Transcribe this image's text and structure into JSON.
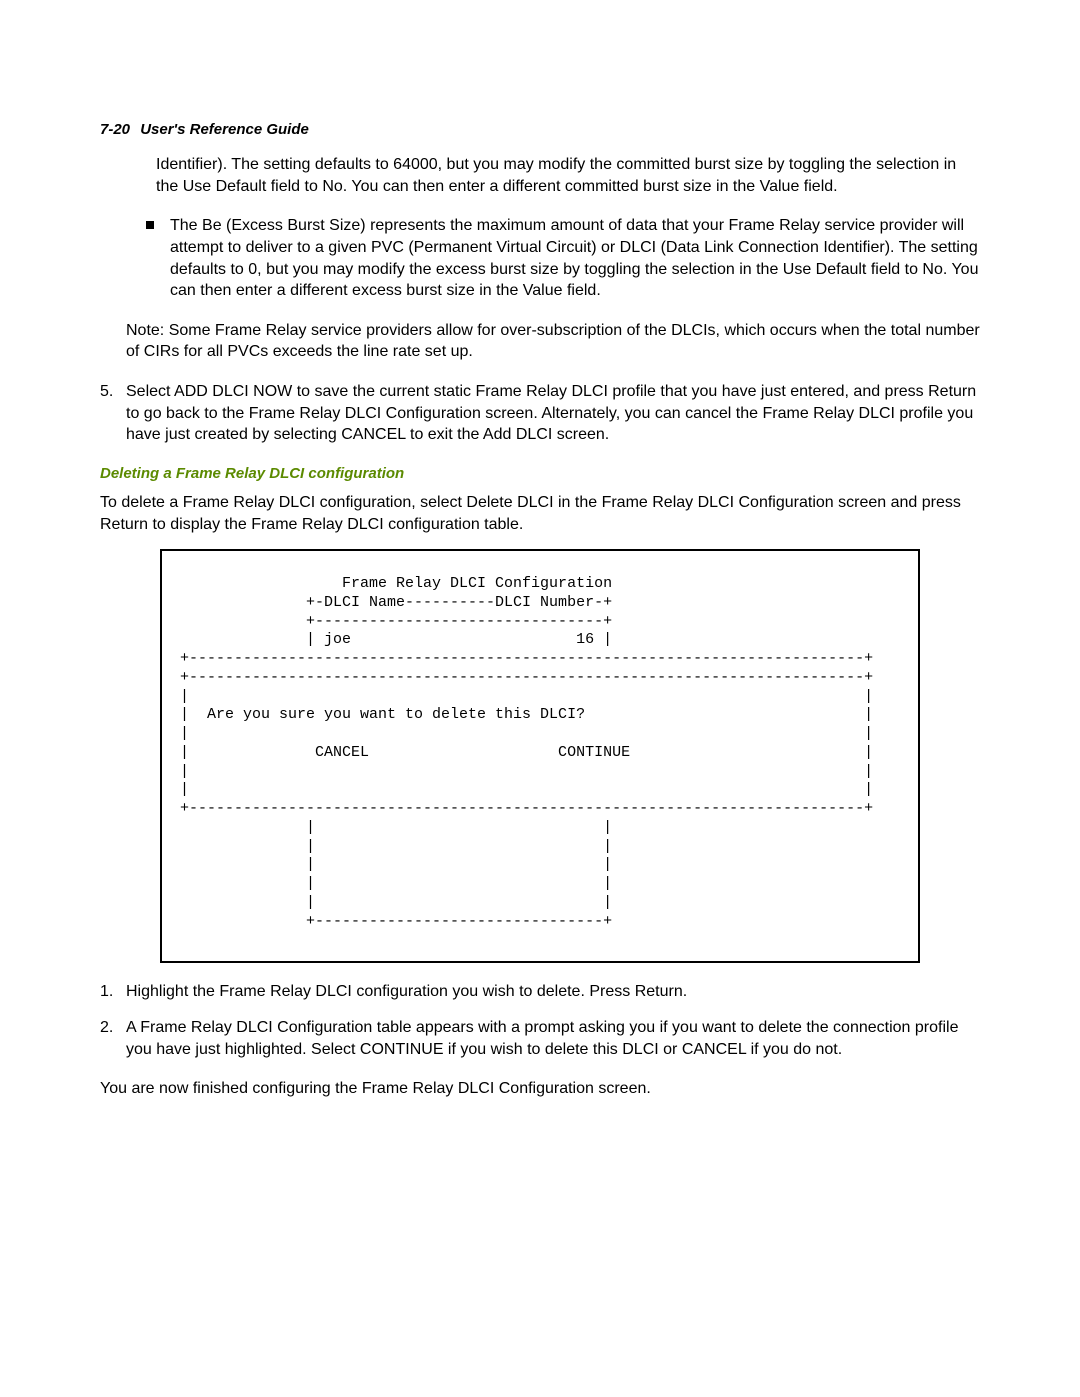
{
  "header": {
    "page_number": "7-20",
    "title": "User's Reference Guide"
  },
  "continuation_para": "Identifier). The setting defaults to 64000, but you may modify the committed burst size by toggling the selection in the Use Default field to No. You can then enter a different committed burst size in the Value field.",
  "bullet_items": [
    "The Be (Excess Burst Size) represents the maximum amount of data that your Frame Relay service provider will attempt to deliver to a given PVC (Permanent Virtual Circuit) or DLCI (Data Link Connection Identifier). The setting defaults to 0, but you may modify the excess burst size by toggling the selection in the Use Default field to No. You can then enter a different excess burst size in the Value field."
  ],
  "note": "Note:  Some Frame Relay service providers allow for over-subscription of the DLCIs, which occurs when the total number of CIRs for all PVCs exceeds the line rate set up.",
  "step5": {
    "num": "5.",
    "text": "Select ADD DLCI NOW to save the current static Frame Relay DLCI profile that you have just entered, and press Return to go back to the Frame Relay DLCI Configuration screen. Alternately, you can cancel the Frame Relay DLCI profile you have just created by selecting CANCEL to exit the Add DLCI screen."
  },
  "section_heading": "Deleting a Frame Relay DLCI configuration",
  "delete_intro": "To delete a Frame Relay DLCI configuration, select Delete DLCI in the Frame Relay DLCI Configuration screen and press Return to display the Frame Relay DLCI configuration table.",
  "screen": "                  Frame Relay DLCI Configuration\n              +-DLCI Name----------DLCI Number-+\n              +--------------------------------+\n              | joe                         16 |\n+---------------------------------------------------------------------------+\n+---------------------------------------------------------------------------+\n|                                                                           |\n|  Are you sure you want to delete this DLCI?                               |\n|                                                                           |\n|              CANCEL                     CONTINUE                          |\n|                                                                           |\n|                                                                           |\n+---------------------------------------------------------------------------+\n              |                                |\n              |                                |\n              |                                |\n              |                                |\n              |                                |\n              +--------------------------------+",
  "steps_after": [
    {
      "num": "1.",
      "text": "Highlight the Frame Relay DLCI configuration you wish to delete. Press Return."
    },
    {
      "num": "2.",
      "text": "A Frame Relay DLCI Configuration table appears with a prompt asking you if you want to delete the connection profile you have just highlighted. Select CONTINUE if you wish to delete this DLCI or CANCEL if you do not."
    }
  ],
  "final_para": "You are now finished configuring the Frame Relay DLCI Configuration screen."
}
